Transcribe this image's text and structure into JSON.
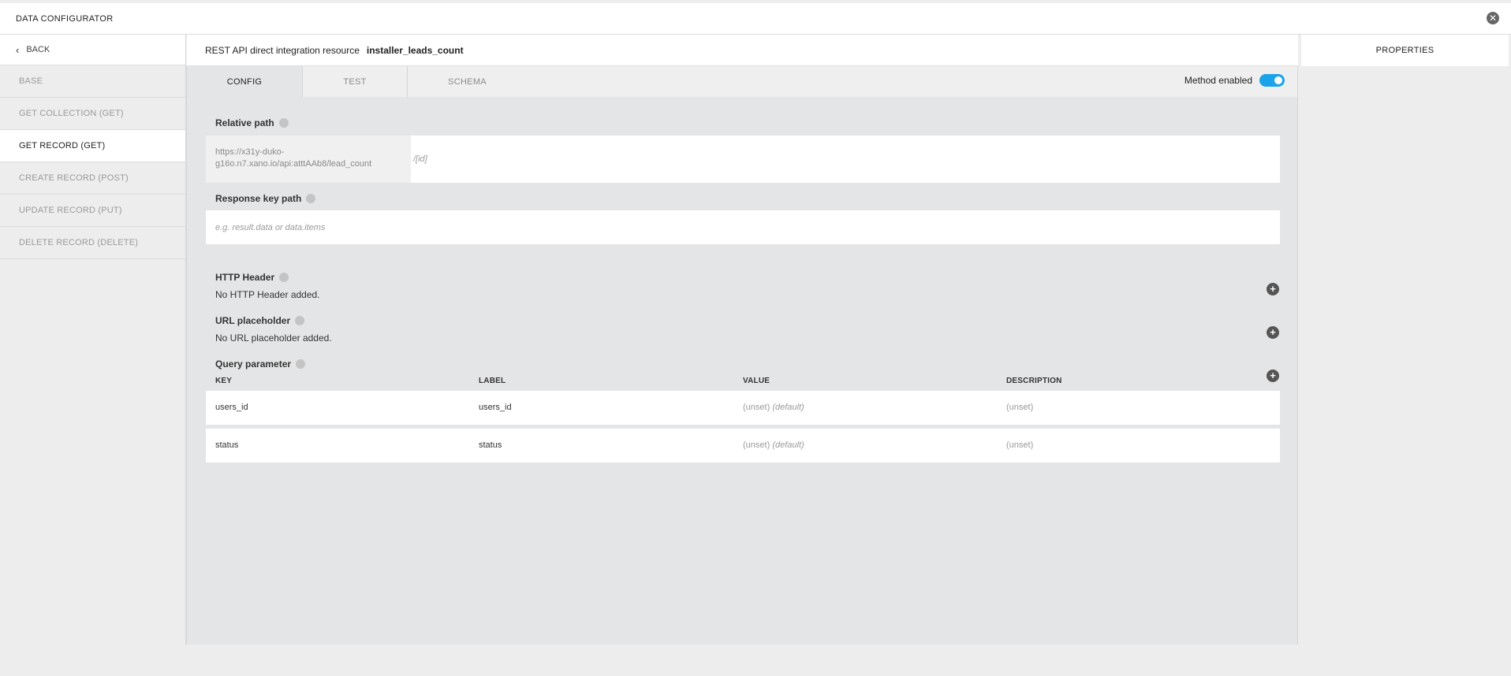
{
  "app": {
    "title": "DATA CONFIGURATOR"
  },
  "sidebar": {
    "back_label": "BACK",
    "items": [
      {
        "label": "BASE",
        "active": false
      },
      {
        "label": "GET COLLECTION (GET)",
        "active": false
      },
      {
        "label": "GET RECORD (GET)",
        "active": true
      },
      {
        "label": "CREATE RECORD (POST)",
        "active": false
      },
      {
        "label": "UPDATE RECORD (PUT)",
        "active": false
      },
      {
        "label": "DELETE RECORD (DELETE)",
        "active": false
      }
    ]
  },
  "header": {
    "prefix": "REST API direct integration resource",
    "resource_name": "installer_leads_count"
  },
  "tabs": [
    {
      "label": "CONFIG",
      "active": true
    },
    {
      "label": "TEST",
      "active": false
    },
    {
      "label": "SCHEMA",
      "active": false
    }
  ],
  "method_enabled": {
    "label": "Method enabled",
    "value": true,
    "color": "#1aa3e8"
  },
  "relative_path": {
    "label": "Relative path",
    "base_url": "https://x31y-duko-g16o.n7.xano.io/api:atttAAb8/lead_count",
    "suffix": "/[id]"
  },
  "response_key_path": {
    "label": "Response key path",
    "placeholder": "e.g. result.data or data.items",
    "value": ""
  },
  "http_header": {
    "label": "HTTP Header",
    "empty_text": "No HTTP Header added."
  },
  "url_placeholder": {
    "label": "URL placeholder",
    "empty_text": "No URL placeholder added."
  },
  "query_parameter": {
    "label": "Query parameter",
    "columns": [
      "KEY",
      "LABEL",
      "VALUE",
      "DESCRIPTION"
    ],
    "rows": [
      {
        "key": "users_id",
        "label": "users_id",
        "value": "(unset)",
        "value_note": "(default)",
        "description": "(unset)"
      },
      {
        "key": "status",
        "label": "status",
        "value": "(unset)",
        "value_note": "(default)",
        "description": "(unset)"
      }
    ]
  },
  "properties_panel": {
    "title": "PROPERTIES"
  },
  "icons": {
    "close": "close-circle-icon",
    "back": "chevron-left-icon",
    "info": "info-icon",
    "add": "plus-circle-icon"
  }
}
